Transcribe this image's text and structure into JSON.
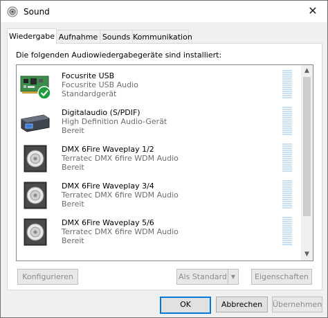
{
  "window": {
    "title": "Sound",
    "close_glyph": "✕"
  },
  "tabs": [
    {
      "label": "Wiedergabe",
      "active": true
    },
    {
      "label": "Aufnahme",
      "active": false
    },
    {
      "label": "Sounds",
      "active": false
    },
    {
      "label": "Kommunikation",
      "active": false
    }
  ],
  "playback": {
    "description": "Die folgenden Audiowiedergabegeräte sind installiert:",
    "devices": [
      {
        "name": "Focusrite USB",
        "driver": "Focusrite USB Audio",
        "status": "Standardgerät",
        "icon": "sound-card-icon",
        "is_default": true
      },
      {
        "name": "Digitalaudio (S/PDIF)",
        "driver": "High Definition Audio-Gerät",
        "status": "Bereit",
        "icon": "spdif-output-icon",
        "is_default": false
      },
      {
        "name": "DMX 6Fire Waveplay 1/2",
        "driver": "Terratec DMX 6fire WDM Audio",
        "status": "Bereit",
        "icon": "speaker-icon",
        "is_default": false
      },
      {
        "name": "DMX 6Fire Waveplay 3/4",
        "driver": "Terratec DMX 6fire WDM Audio",
        "status": "Bereit",
        "icon": "speaker-icon",
        "is_default": false
      },
      {
        "name": "DMX 6Fire Waveplay 5/6",
        "driver": "Terratec DMX 6fire WDM Audio",
        "status": "Bereit",
        "icon": "speaker-icon",
        "is_default": false
      }
    ],
    "buttons": {
      "configure": "Konfigurieren",
      "set_default": "Als Standard",
      "properties": "Eigenschaften"
    }
  },
  "footer": {
    "ok": "OK",
    "cancel": "Abbrechen",
    "apply": "Übernehmen"
  },
  "colors": {
    "accent": "#0078d7",
    "default_check": "#1e9b3c",
    "meter": "#c9e0f2"
  }
}
